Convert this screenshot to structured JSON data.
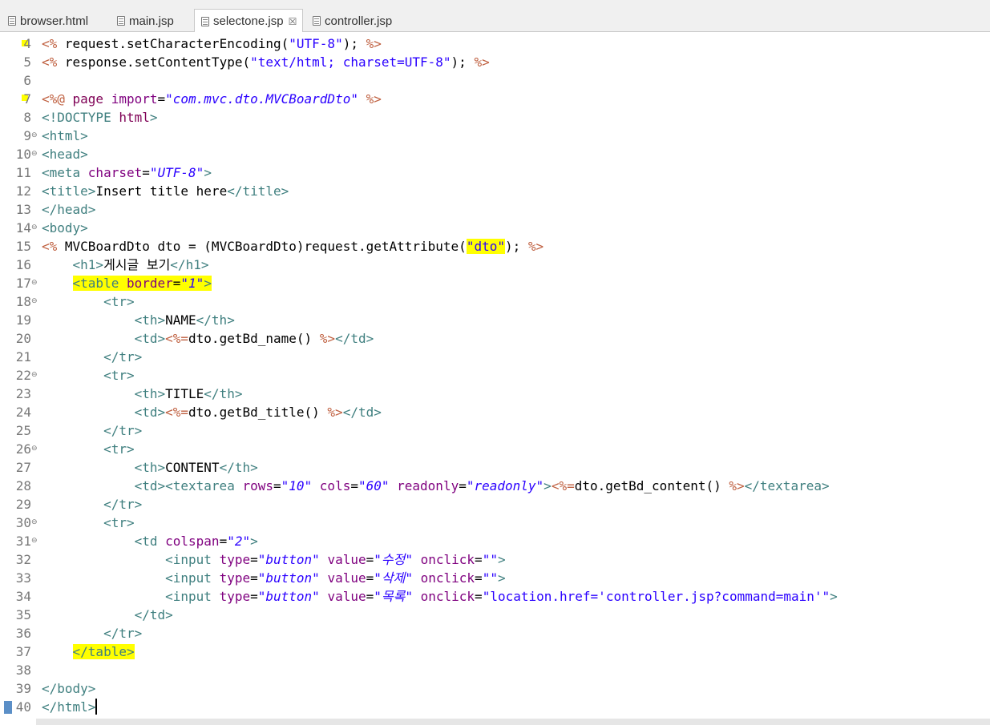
{
  "tabs": [
    {
      "label": "browser.html",
      "active": false
    },
    {
      "label": "main.jsp",
      "active": false
    },
    {
      "label": "selectone.jsp",
      "active": true,
      "close": "☒"
    },
    {
      "label": "controller.jsp",
      "active": false
    }
  ],
  "lines": [
    {
      "num": "4",
      "fold": false,
      "tokens": [
        {
          "c": "scr",
          "t": "<% "
        },
        {
          "c": "txt",
          "t": "request.setCharacterEncoding("
        },
        {
          "c": "str",
          "t": "\"UTF-8\""
        },
        {
          "c": "txt",
          "t": "); "
        },
        {
          "c": "scr",
          "t": "%>"
        }
      ]
    },
    {
      "num": "5",
      "fold": false,
      "tokens": [
        {
          "c": "scr",
          "t": "<% "
        },
        {
          "c": "txt",
          "t": "response.setContentType("
        },
        {
          "c": "str",
          "t": "\"text/html; charset=UTF-8\""
        },
        {
          "c": "txt",
          "t": "); "
        },
        {
          "c": "scr",
          "t": "%>"
        }
      ]
    },
    {
      "num": "6",
      "fold": false,
      "tokens": []
    },
    {
      "num": "7",
      "fold": false,
      "tokens": [
        {
          "c": "scr",
          "t": "<%@ "
        },
        {
          "c": "kw",
          "t": "page "
        },
        {
          "c": "attr",
          "t": "import"
        },
        {
          "c": "txt",
          "t": "="
        },
        {
          "c": "it",
          "t": "\"com.mvc.dto.MVCBoardDto\""
        },
        {
          "c": "txt",
          "t": " "
        },
        {
          "c": "scr",
          "t": "%>"
        }
      ]
    },
    {
      "num": "8",
      "fold": false,
      "tokens": [
        {
          "c": "tag",
          "t": "<!DOCTYPE "
        },
        {
          "c": "kw",
          "t": "html"
        },
        {
          "c": "tag",
          "t": ">"
        }
      ]
    },
    {
      "num": "9",
      "fold": true,
      "tokens": [
        {
          "c": "tag",
          "t": "<html>"
        }
      ]
    },
    {
      "num": "10",
      "fold": true,
      "tokens": [
        {
          "c": "tag",
          "t": "<head>"
        }
      ]
    },
    {
      "num": "11",
      "fold": false,
      "tokens": [
        {
          "c": "tag",
          "t": "<meta "
        },
        {
          "c": "attr",
          "t": "charset"
        },
        {
          "c": "txt",
          "t": "="
        },
        {
          "c": "it",
          "t": "\"UTF-8\""
        },
        {
          "c": "tag",
          "t": ">"
        }
      ]
    },
    {
      "num": "12",
      "fold": false,
      "tokens": [
        {
          "c": "tag",
          "t": "<title>"
        },
        {
          "c": "txt",
          "t": "Insert title here"
        },
        {
          "c": "tag",
          "t": "</title>"
        }
      ]
    },
    {
      "num": "13",
      "fold": false,
      "tokens": [
        {
          "c": "tag",
          "t": "</head>"
        }
      ]
    },
    {
      "num": "14",
      "fold": true,
      "tokens": [
        {
          "c": "tag",
          "t": "<body>"
        }
      ]
    },
    {
      "num": "15",
      "fold": false,
      "tokens": [
        {
          "c": "scr",
          "t": "<% "
        },
        {
          "c": "txt",
          "t": "MVCBoardDto dto = (MVCBoardDto)request.getAttribute("
        },
        {
          "c": "str",
          "t": "\"dto\"",
          "hl": true
        },
        {
          "c": "txt",
          "t": "); "
        },
        {
          "c": "scr",
          "t": "%>"
        }
      ]
    },
    {
      "num": "16",
      "fold": false,
      "tokens": [
        {
          "c": "txt",
          "t": "    "
        },
        {
          "c": "tag",
          "t": "<h1>"
        },
        {
          "c": "txt",
          "t": "게시글 보기"
        },
        {
          "c": "tag",
          "t": "</h1>"
        }
      ]
    },
    {
      "num": "17",
      "fold": true,
      "tokens": [
        {
          "c": "txt",
          "t": "    "
        },
        {
          "c": "tag",
          "t": "<table ",
          "hl": true
        },
        {
          "c": "attr",
          "t": "border",
          "hl": true
        },
        {
          "c": "txt",
          "t": "=",
          "hl": true
        },
        {
          "c": "it",
          "t": "\"1\"",
          "hl": true
        },
        {
          "c": "tag",
          "t": ">",
          "hl": true
        }
      ]
    },
    {
      "num": "18",
      "fold": true,
      "tokens": [
        {
          "c": "txt",
          "t": "        "
        },
        {
          "c": "tag",
          "t": "<tr>"
        }
      ]
    },
    {
      "num": "19",
      "fold": false,
      "tokens": [
        {
          "c": "txt",
          "t": "            "
        },
        {
          "c": "tag",
          "t": "<th>"
        },
        {
          "c": "txt",
          "t": "NAME"
        },
        {
          "c": "tag",
          "t": "</th>"
        }
      ]
    },
    {
      "num": "20",
      "fold": false,
      "tokens": [
        {
          "c": "txt",
          "t": "            "
        },
        {
          "c": "tag",
          "t": "<td>"
        },
        {
          "c": "scr",
          "t": "<%="
        },
        {
          "c": "txt",
          "t": "dto.getBd_name() "
        },
        {
          "c": "scr",
          "t": "%>"
        },
        {
          "c": "tag",
          "t": "</td>"
        }
      ]
    },
    {
      "num": "21",
      "fold": false,
      "tokens": [
        {
          "c": "txt",
          "t": "        "
        },
        {
          "c": "tag",
          "t": "</tr>"
        }
      ]
    },
    {
      "num": "22",
      "fold": true,
      "tokens": [
        {
          "c": "txt",
          "t": "        "
        },
        {
          "c": "tag",
          "t": "<tr>"
        }
      ]
    },
    {
      "num": "23",
      "fold": false,
      "tokens": [
        {
          "c": "txt",
          "t": "            "
        },
        {
          "c": "tag",
          "t": "<th>"
        },
        {
          "c": "txt",
          "t": "TITLE"
        },
        {
          "c": "tag",
          "t": "</th>"
        }
      ]
    },
    {
      "num": "24",
      "fold": false,
      "tokens": [
        {
          "c": "txt",
          "t": "            "
        },
        {
          "c": "tag",
          "t": "<td>"
        },
        {
          "c": "scr",
          "t": "<%="
        },
        {
          "c": "txt",
          "t": "dto.getBd_title() "
        },
        {
          "c": "scr",
          "t": "%>"
        },
        {
          "c": "tag",
          "t": "</td>"
        }
      ]
    },
    {
      "num": "25",
      "fold": false,
      "tokens": [
        {
          "c": "txt",
          "t": "        "
        },
        {
          "c": "tag",
          "t": "</tr>"
        }
      ]
    },
    {
      "num": "26",
      "fold": true,
      "tokens": [
        {
          "c": "txt",
          "t": "        "
        },
        {
          "c": "tag",
          "t": "<tr>"
        }
      ]
    },
    {
      "num": "27",
      "fold": false,
      "tokens": [
        {
          "c": "txt",
          "t": "            "
        },
        {
          "c": "tag",
          "t": "<th>"
        },
        {
          "c": "txt",
          "t": "CONTENT"
        },
        {
          "c": "tag",
          "t": "</th>"
        }
      ]
    },
    {
      "num": "28",
      "fold": false,
      "tokens": [
        {
          "c": "txt",
          "t": "            "
        },
        {
          "c": "tag",
          "t": "<td><textarea "
        },
        {
          "c": "attr",
          "t": "rows"
        },
        {
          "c": "txt",
          "t": "="
        },
        {
          "c": "it",
          "t": "\"10\""
        },
        {
          "c": "txt",
          "t": " "
        },
        {
          "c": "attr",
          "t": "cols"
        },
        {
          "c": "txt",
          "t": "="
        },
        {
          "c": "it",
          "t": "\"60\""
        },
        {
          "c": "txt",
          "t": " "
        },
        {
          "c": "attr",
          "t": "readonly"
        },
        {
          "c": "txt",
          "t": "="
        },
        {
          "c": "it",
          "t": "\"readonly\""
        },
        {
          "c": "tag",
          "t": ">"
        },
        {
          "c": "scr",
          "t": "<%="
        },
        {
          "c": "txt",
          "t": "dto.getBd_content() "
        },
        {
          "c": "scr",
          "t": "%>"
        },
        {
          "c": "tag",
          "t": "</textarea>"
        }
      ]
    },
    {
      "num": "29",
      "fold": false,
      "tokens": [
        {
          "c": "txt",
          "t": "        "
        },
        {
          "c": "tag",
          "t": "</tr>"
        }
      ]
    },
    {
      "num": "30",
      "fold": true,
      "tokens": [
        {
          "c": "txt",
          "t": "        "
        },
        {
          "c": "tag",
          "t": "<tr>"
        }
      ]
    },
    {
      "num": "31",
      "fold": true,
      "tokens": [
        {
          "c": "txt",
          "t": "            "
        },
        {
          "c": "tag",
          "t": "<td "
        },
        {
          "c": "attr",
          "t": "colspan"
        },
        {
          "c": "txt",
          "t": "="
        },
        {
          "c": "it",
          "t": "\"2\""
        },
        {
          "c": "tag",
          "t": ">"
        }
      ]
    },
    {
      "num": "32",
      "fold": false,
      "tokens": [
        {
          "c": "txt",
          "t": "                "
        },
        {
          "c": "tag",
          "t": "<input "
        },
        {
          "c": "attr",
          "t": "type"
        },
        {
          "c": "txt",
          "t": "="
        },
        {
          "c": "it",
          "t": "\"button\""
        },
        {
          "c": "txt",
          "t": " "
        },
        {
          "c": "attr",
          "t": "value"
        },
        {
          "c": "txt",
          "t": "="
        },
        {
          "c": "it",
          "t": "\"수정\""
        },
        {
          "c": "txt",
          "t": " "
        },
        {
          "c": "attr",
          "t": "onclick"
        },
        {
          "c": "txt",
          "t": "="
        },
        {
          "c": "str",
          "t": "\"\""
        },
        {
          "c": "tag",
          "t": ">"
        }
      ]
    },
    {
      "num": "33",
      "fold": false,
      "tokens": [
        {
          "c": "txt",
          "t": "                "
        },
        {
          "c": "tag",
          "t": "<input "
        },
        {
          "c": "attr",
          "t": "type"
        },
        {
          "c": "txt",
          "t": "="
        },
        {
          "c": "it",
          "t": "\"button\""
        },
        {
          "c": "txt",
          "t": " "
        },
        {
          "c": "attr",
          "t": "value"
        },
        {
          "c": "txt",
          "t": "="
        },
        {
          "c": "it",
          "t": "\"삭제\""
        },
        {
          "c": "txt",
          "t": " "
        },
        {
          "c": "attr",
          "t": "onclick"
        },
        {
          "c": "txt",
          "t": "="
        },
        {
          "c": "str",
          "t": "\"\""
        },
        {
          "c": "tag",
          "t": ">"
        }
      ]
    },
    {
      "num": "34",
      "fold": false,
      "tokens": [
        {
          "c": "txt",
          "t": "                "
        },
        {
          "c": "tag",
          "t": "<input "
        },
        {
          "c": "attr",
          "t": "type"
        },
        {
          "c": "txt",
          "t": "="
        },
        {
          "c": "it",
          "t": "\"button\""
        },
        {
          "c": "txt",
          "t": " "
        },
        {
          "c": "attr",
          "t": "value"
        },
        {
          "c": "txt",
          "t": "="
        },
        {
          "c": "it",
          "t": "\"목록\""
        },
        {
          "c": "txt",
          "t": " "
        },
        {
          "c": "attr",
          "t": "onclick"
        },
        {
          "c": "txt",
          "t": "="
        },
        {
          "c": "str",
          "t": "\"location.href='controller.jsp?command=main'\""
        },
        {
          "c": "tag",
          "t": ">"
        }
      ]
    },
    {
      "num": "35",
      "fold": false,
      "tokens": [
        {
          "c": "txt",
          "t": "            "
        },
        {
          "c": "tag",
          "t": "</td>"
        }
      ]
    },
    {
      "num": "36",
      "fold": false,
      "tokens": [
        {
          "c": "txt",
          "t": "        "
        },
        {
          "c": "tag",
          "t": "</tr>"
        }
      ]
    },
    {
      "num": "37",
      "fold": false,
      "tokens": [
        {
          "c": "txt",
          "t": "    "
        },
        {
          "c": "tag",
          "t": "</table>",
          "hl": true
        }
      ]
    },
    {
      "num": "38",
      "fold": false,
      "tokens": []
    },
    {
      "num": "39",
      "fold": false,
      "tokens": [
        {
          "c": "tag",
          "t": "</body>"
        }
      ]
    },
    {
      "num": "40",
      "fold": false,
      "tokens": [
        {
          "c": "tag",
          "t": "</html>"
        }
      ]
    }
  ],
  "colors": {
    "jsp_delimiter": "#bf5f3f",
    "string": "#2a00ff",
    "tag": "#3f7f7f",
    "attribute": "#7f007f",
    "keyword": "#7f0055",
    "highlight": "#ffff00"
  },
  "icons": {
    "tab_file": "file-icon",
    "fold": "fold-minus-icon"
  }
}
